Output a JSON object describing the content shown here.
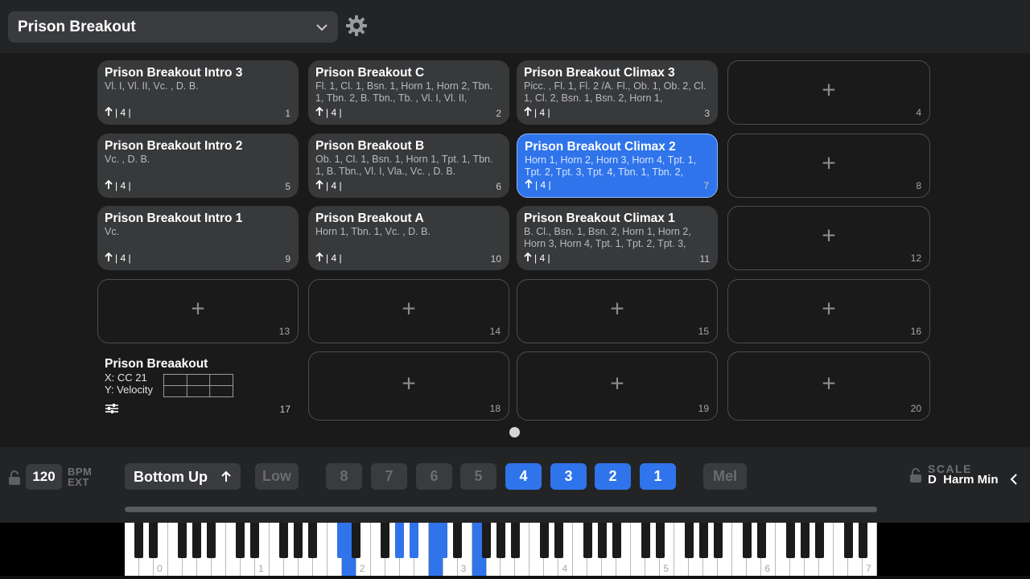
{
  "header": {
    "preset": "Prison Breakout"
  },
  "slots": [
    {
      "num": "1",
      "title": "Prison Breakout Intro 3",
      "desc": "Vl. I, Vl. II, Vc. , D. B.",
      "foot": "| 4 |",
      "state": "filled"
    },
    {
      "num": "2",
      "title": "Prison Breakout C",
      "desc": "Fl. 1, Cl. 1, Bsn. 1, Horn 1, Horn 2, Tbn. 1, Tbn. 2, B. Tbn., Tb. , Vl. I, Vl. II,",
      "foot": "| 4 |",
      "state": "filled"
    },
    {
      "num": "3",
      "title": "Prison Breakout Climax 3",
      "desc": "Picc. , Fl. 1, Fl. 2 /A. Fl., Ob. 1, Ob. 2, Cl. 1, Cl. 2, Bsn. 1, Bsn. 2, Horn 1,",
      "foot": "| 4 |",
      "state": "filled"
    },
    {
      "num": "4",
      "state": "empty"
    },
    {
      "num": "5",
      "title": "Prison Breakout Intro 2",
      "desc": "Vc. , D. B.",
      "foot": "| 4 |",
      "state": "filled"
    },
    {
      "num": "6",
      "title": "Prison Breakout B",
      "desc": "Ob. 1, Cl. 1, Bsn. 1, Horn 1, Tpt. 1, Tbn. 1, B. Tbn., Vl. I, Vla., Vc. , D. B.",
      "foot": "| 4 |",
      "state": "filled"
    },
    {
      "num": "7",
      "title": "Prison Breakout Climax 2",
      "desc": "Horn 1, Horn 2, Horn 3, Horn 4, Tpt. 1, Tpt. 2, Tpt. 3, Tpt. 4, Tbn. 1, Tbn. 2,",
      "foot": "| 4 |",
      "state": "active"
    },
    {
      "num": "8",
      "state": "empty"
    },
    {
      "num": "9",
      "title": "Prison Breakout Intro 1",
      "desc": "Vc.",
      "foot": "| 4 |",
      "state": "filled"
    },
    {
      "num": "10",
      "title": "Prison Breakout A",
      "desc": "Horn 1, Tbn. 1, Vc. , D. B.",
      "foot": "| 4 |",
      "state": "filled"
    },
    {
      "num": "11",
      "title": "Prison Breakout Climax 1",
      "desc": "B. Cl., Bsn. 1, Bsn. 2, Horn 1, Horn 2, Horn 3, Horn 4, Tpt. 1, Tpt. 2, Tpt. 3,",
      "foot": "| 4 |",
      "state": "filled"
    },
    {
      "num": "12",
      "state": "empty"
    },
    {
      "num": "13",
      "state": "empty"
    },
    {
      "num": "14",
      "state": "empty"
    },
    {
      "num": "15",
      "state": "empty"
    },
    {
      "num": "16",
      "state": "empty"
    },
    {
      "num": "17",
      "title": "Prison Breaakout",
      "x_line": "X: CC 21",
      "y_line": "Y: Velocity",
      "state": "xy"
    },
    {
      "num": "18",
      "state": "empty"
    },
    {
      "num": "19",
      "state": "empty"
    },
    {
      "num": "20",
      "state": "empty"
    }
  ],
  "plus_glyph": "+",
  "controls": {
    "bpm_value": "120",
    "bpm_label": "BPM",
    "ext_label": "EXT",
    "mode": "Bottom Up",
    "low": "Low",
    "voices": [
      {
        "label": "8",
        "on": false
      },
      {
        "label": "7",
        "on": false
      },
      {
        "label": "6",
        "on": false
      },
      {
        "label": "5",
        "on": false
      },
      {
        "label": "4",
        "on": true
      },
      {
        "label": "3",
        "on": true
      },
      {
        "label": "2",
        "on": true
      },
      {
        "label": "1",
        "on": true
      }
    ],
    "mel": "Mel",
    "scale_label": "SCALE",
    "scale_value": "D  Harm Min"
  },
  "keyboard": {
    "octave_labels": [
      "0",
      "1",
      "2",
      "3",
      "4",
      "5",
      "6",
      "7"
    ],
    "highlighted_keys": [
      "D2 (white)",
      "D#2",
      "A#2",
      "C#3",
      "D3 (white)",
      "D#3",
      "F3 (white)"
    ],
    "accent": "#2f74ea"
  }
}
